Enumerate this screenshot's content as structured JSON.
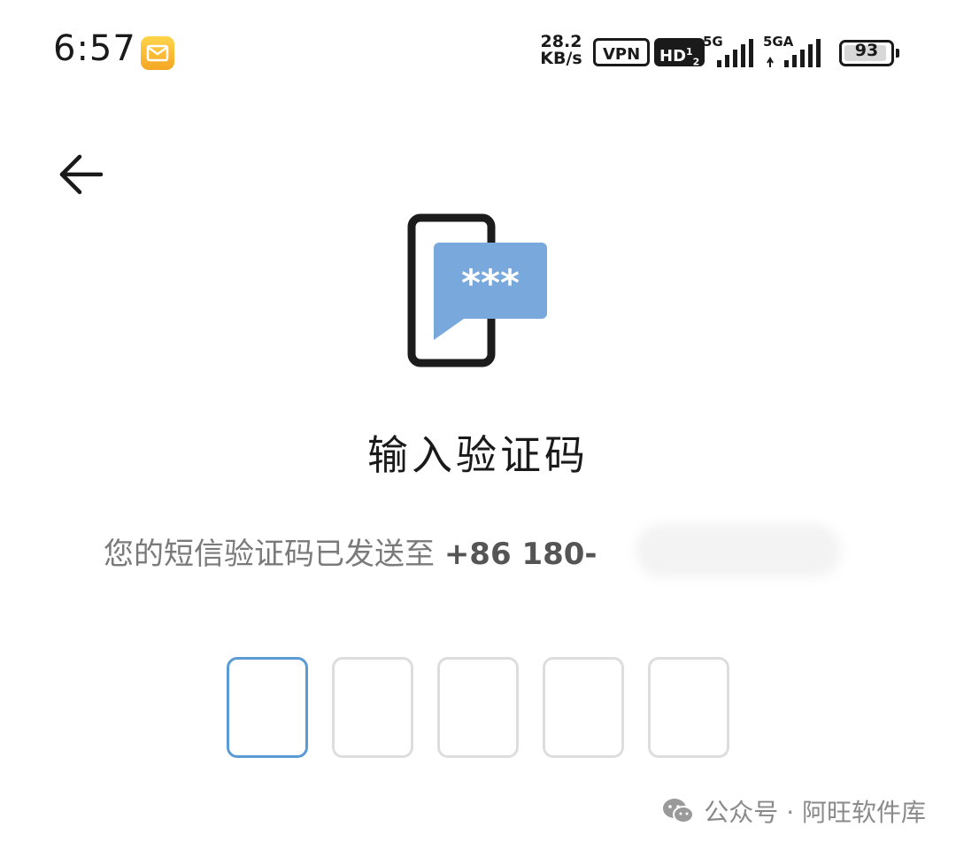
{
  "status_bar": {
    "time": "6:57",
    "mail_icon": "mail-notification-icon",
    "net_speed_value": "28.2",
    "net_speed_unit": "KB/s",
    "vpn_label": "VPN",
    "hd_label": "HD",
    "hd_sup": "1",
    "hd_sub": "2",
    "signal_1_label": "5G",
    "signal_2_label": "5GA",
    "battery_level": "93",
    "battery_fraction": 0.93
  },
  "nav": {
    "back_icon": "back-arrow-icon"
  },
  "hero": {
    "icon": "phone-sms-code-icon",
    "icon_color": "#78a8dc",
    "bubble_text": "***"
  },
  "main": {
    "title": "输入验证码",
    "subtitle_prefix": "您的短信验证码已发送至 ",
    "phone_visible": "+86 180-"
  },
  "code_input": {
    "box_count": 5,
    "active_index": 0,
    "active_color": "#5b9bd5",
    "inactive_color": "#dddddd",
    "values": [
      "",
      "",
      "",
      "",
      ""
    ]
  },
  "watermark": {
    "icon": "wechat-icon",
    "text": "公众号 · 阿旺软件库"
  }
}
